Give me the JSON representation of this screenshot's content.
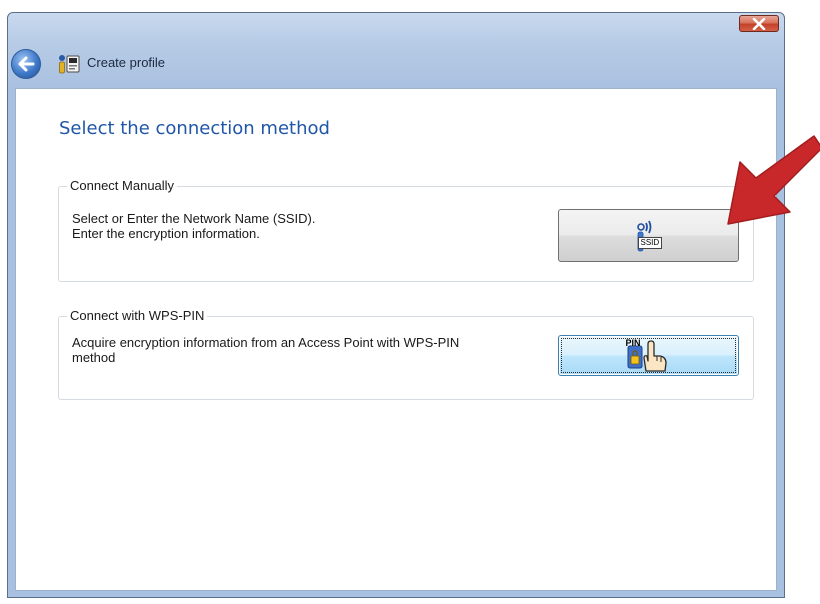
{
  "window": {
    "title": "Create profile",
    "close_symbol": "✕"
  },
  "icons": {
    "back": "back-arrow-icon",
    "title": "wireless-profile-icon",
    "ssid": "ssid-signal-icon",
    "pin": "pin-hand-icon",
    "annotation": "red-arrow-icon"
  },
  "main": {
    "heading": "Select the connection method",
    "groups": [
      {
        "legend": "Connect Manually",
        "lines": [
          "Select or Enter the Network Name (SSID).",
          "Enter the encryption information."
        ],
        "button_tag": "SSID"
      },
      {
        "legend": "Connect with WPS-PIN",
        "lines": [
          "Acquire encryption information from an Access Point with WPS-PIN",
          "method"
        ],
        "button_tag": "PIN"
      }
    ]
  },
  "colors": {
    "heading": "#1f56a8",
    "frame": "#b7cbe6",
    "close": "#c2432a",
    "arrow": "#c8282a",
    "focused_button": "#bee6fd"
  }
}
